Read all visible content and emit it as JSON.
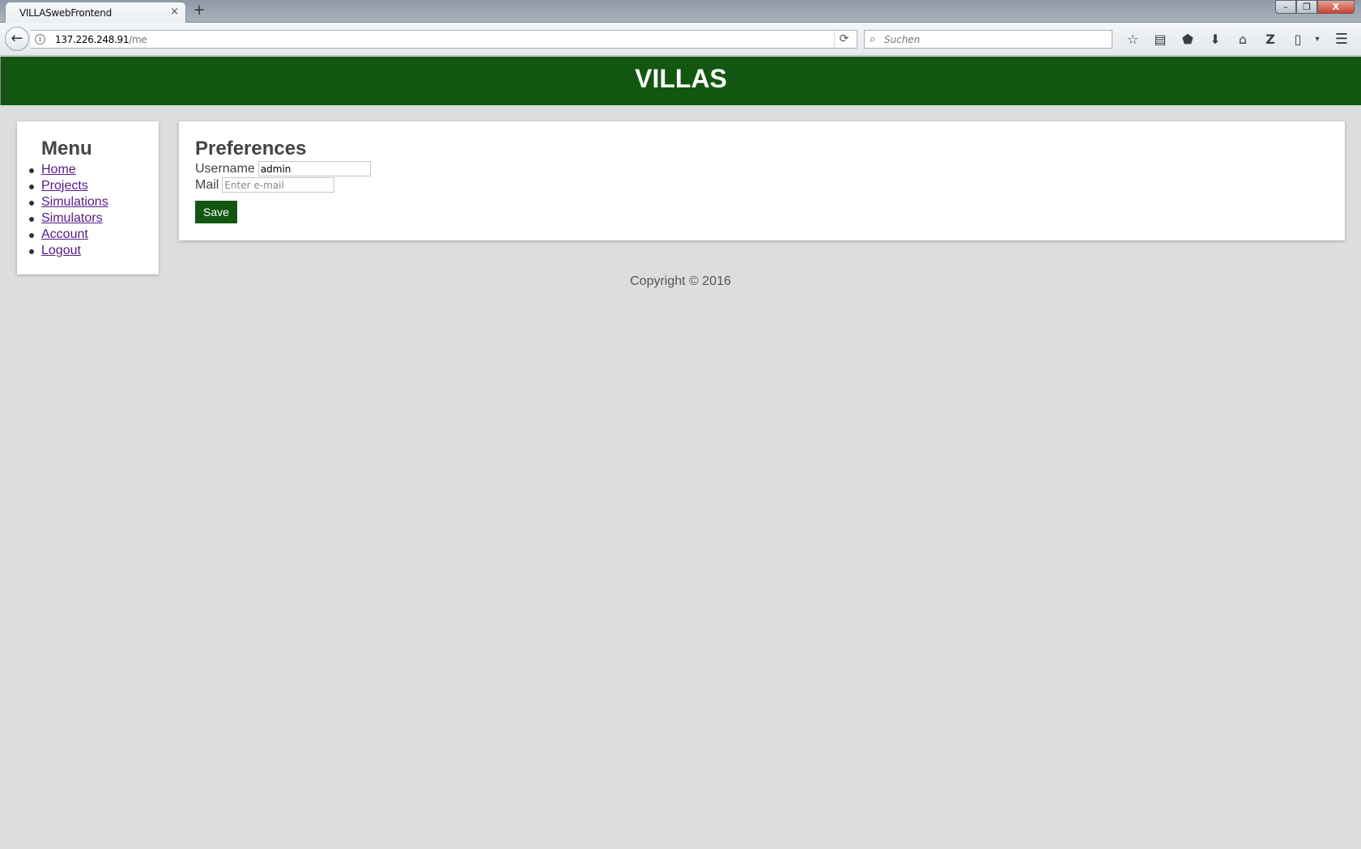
{
  "browser": {
    "tab_title": "VILLASwebFrontend",
    "tab_close": "×",
    "new_tab": "+",
    "window_controls": {
      "minimize": "–",
      "restore": "❐",
      "close": "X"
    },
    "url_host": "137.226.248.91",
    "url_path": "/me",
    "search_placeholder": "Suchen",
    "icons": [
      "back-arrow-icon",
      "info-icon",
      "reload-icon",
      "search-icon",
      "bookmark-star-icon",
      "reading-list-icon",
      "pocket-icon",
      "download-icon",
      "home-icon",
      "zotero-icon",
      "page-icon",
      "dropdown-icon",
      "hamburger-menu-icon"
    ]
  },
  "header": {
    "brand": "VILLAS"
  },
  "menu": {
    "title": "Menu",
    "items": [
      {
        "label": "Home"
      },
      {
        "label": "Projects"
      },
      {
        "label": "Simulations"
      },
      {
        "label": "Simulators"
      },
      {
        "label": "Account"
      },
      {
        "label": "Logout"
      }
    ]
  },
  "preferences": {
    "title": "Preferences",
    "username_label": "Username",
    "username_value": "admin",
    "mail_label": "Mail",
    "mail_placeholder": "Enter e-mail",
    "save_label": "Save"
  },
  "footer": {
    "text": "Copyright © 2016"
  },
  "colors": {
    "brand_green": "#135612",
    "page_bg": "#dddddd",
    "link": "#551a8b"
  }
}
